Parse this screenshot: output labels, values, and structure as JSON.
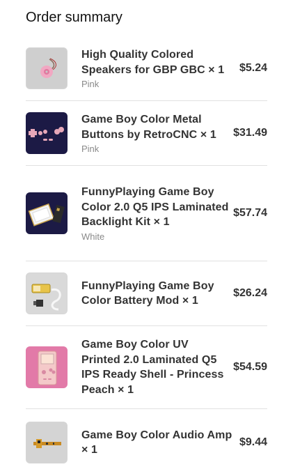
{
  "heading": "Order summary",
  "items": [
    {
      "name": "High Quality Colored Speakers for GBP GBC × 1",
      "variant": "Pink",
      "price": "$5.24",
      "thumb_icon": "speaker-icon",
      "thumb_bg": "#cfcfcf"
    },
    {
      "name": "Game Boy Color Metal Buttons by RetroCNC × 1",
      "variant": "Pink",
      "price": "$31.49",
      "thumb_icon": "buttons-icon",
      "thumb_bg": "#1c1a45"
    },
    {
      "name": "FunnyPlaying Game Boy Color 2.0 Q5 IPS Laminated Backlight Kit × 1",
      "variant": "White",
      "price": "$57.74",
      "thumb_icon": "screen-kit-icon",
      "thumb_bg": "#1c1a45"
    },
    {
      "name": "FunnyPlaying Game Boy Color Battery Mod × 1",
      "variant": "",
      "price": "$26.24",
      "thumb_icon": "battery-icon",
      "thumb_bg": "#d9d9d9"
    },
    {
      "name": "Game Boy Color UV Printed 2.0 Laminated Q5 IPS Ready Shell - Princess Peach × 1",
      "variant": "",
      "price": "$54.59",
      "thumb_icon": "shell-icon",
      "thumb_bg": "#e27aa8"
    },
    {
      "name": "Game Boy Color Audio Amp × 1",
      "variant": "",
      "price": "$9.44",
      "thumb_icon": "audio-amp-icon",
      "thumb_bg": "#d4d4d4"
    }
  ]
}
